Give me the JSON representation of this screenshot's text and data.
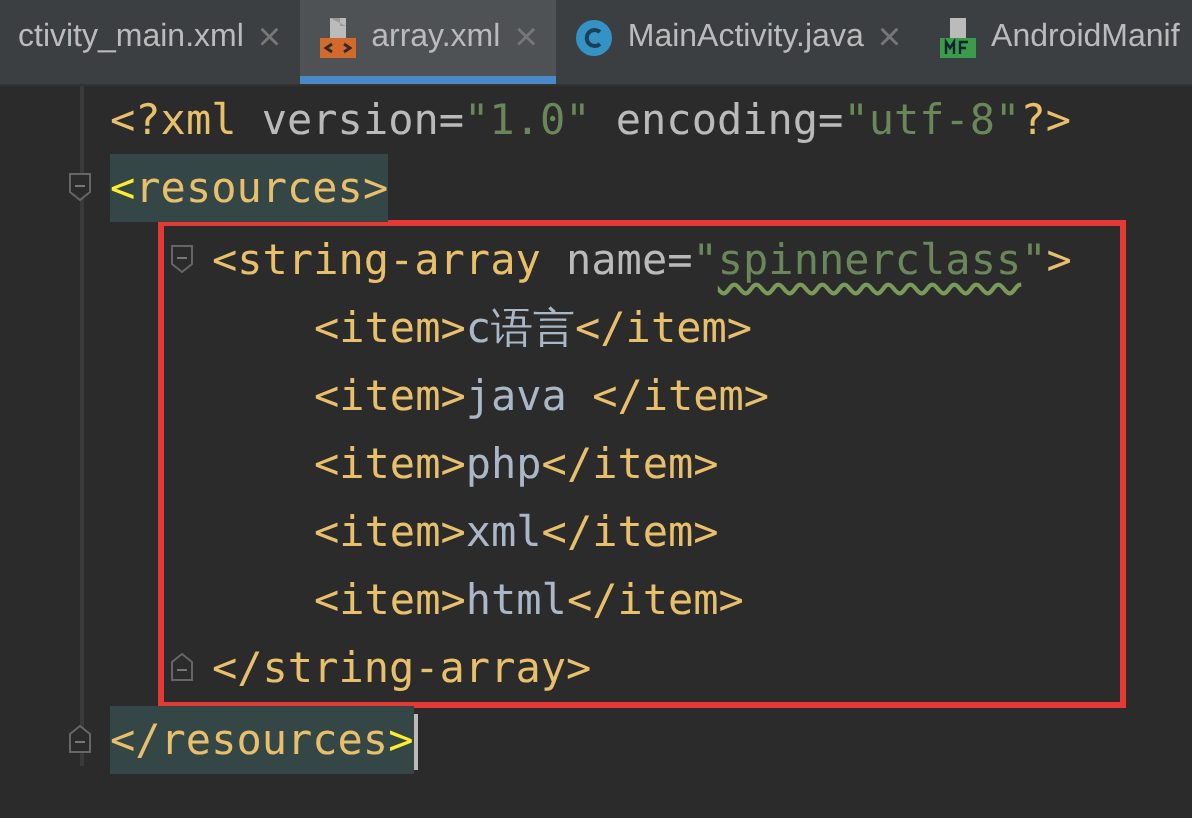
{
  "tabs": [
    {
      "label": "ctivity_main.xml",
      "kind": "plain",
      "selected": false,
      "close": "×"
    },
    {
      "label": "array.xml",
      "kind": "xml",
      "selected": true,
      "close": "×"
    },
    {
      "label": "MainActivity.java",
      "kind": "class",
      "selected": false,
      "close": "×"
    },
    {
      "label": "AndroidManif",
      "kind": "manifest",
      "selected": false
    }
  ],
  "code": [
    {
      "tokens": [
        {
          "kind": "punct",
          "text": "<?"
        },
        {
          "kind": "tag",
          "text": "xml "
        },
        {
          "kind": "attr",
          "text": "version="
        },
        {
          "kind": "value",
          "text": "\"1.0\""
        },
        {
          "kind": "attr",
          "text": " encoding="
        },
        {
          "kind": "value",
          "text": "\"utf-8\""
        },
        {
          "kind": "punct",
          "text": "?>"
        }
      ]
    },
    {
      "highlighted": true,
      "tokens": [
        {
          "kind": "match",
          "text": "<"
        },
        {
          "kind": "tag",
          "text": "resources>"
        }
      ],
      "close": [
        {
          "kind": "tag",
          "text": "</resources"
        },
        {
          "kind": "match",
          "text": ">"
        }
      ],
      "caret": true,
      "children": [
        {
          "boxed": true,
          "tokens": [
            {
              "kind": "tag",
              "text": "<string-array "
            },
            {
              "kind": "attr",
              "text": "name="
            },
            {
              "kind": "value",
              "text": "\""
            },
            {
              "kind": "value",
              "text": "spinnerclass",
              "misspelled": true
            },
            {
              "kind": "value",
              "text": "\""
            },
            {
              "kind": "tag",
              "text": ">"
            }
          ],
          "close": [
            {
              "kind": "tag",
              "text": "</string-array>"
            }
          ],
          "children": [
            {
              "tokens": [
                {
                  "kind": "tag",
                  "text": "<item>"
                },
                {
                  "kind": "text",
                  "text": "c语言"
                },
                {
                  "kind": "tag",
                  "text": "</item>"
                }
              ]
            },
            {
              "tokens": [
                {
                  "kind": "tag",
                  "text": "<item>"
                },
                {
                  "kind": "text",
                  "text": "java "
                },
                {
                  "kind": "tag",
                  "text": "</item>"
                }
              ]
            },
            {
              "tokens": [
                {
                  "kind": "tag",
                  "text": "<item>"
                },
                {
                  "kind": "text",
                  "text": "php"
                },
                {
                  "kind": "tag",
                  "text": "</item>"
                }
              ]
            },
            {
              "tokens": [
                {
                  "kind": "tag",
                  "text": "<item>"
                },
                {
                  "kind": "text",
                  "text": "xml"
                },
                {
                  "kind": "tag",
                  "text": "</item>"
                }
              ]
            },
            {
              "tokens": [
                {
                  "kind": "tag",
                  "text": "<item>"
                },
                {
                  "kind": "text",
                  "text": "html"
                },
                {
                  "kind": "tag",
                  "text": "</item>"
                }
              ]
            }
          ]
        }
      ]
    }
  ]
}
